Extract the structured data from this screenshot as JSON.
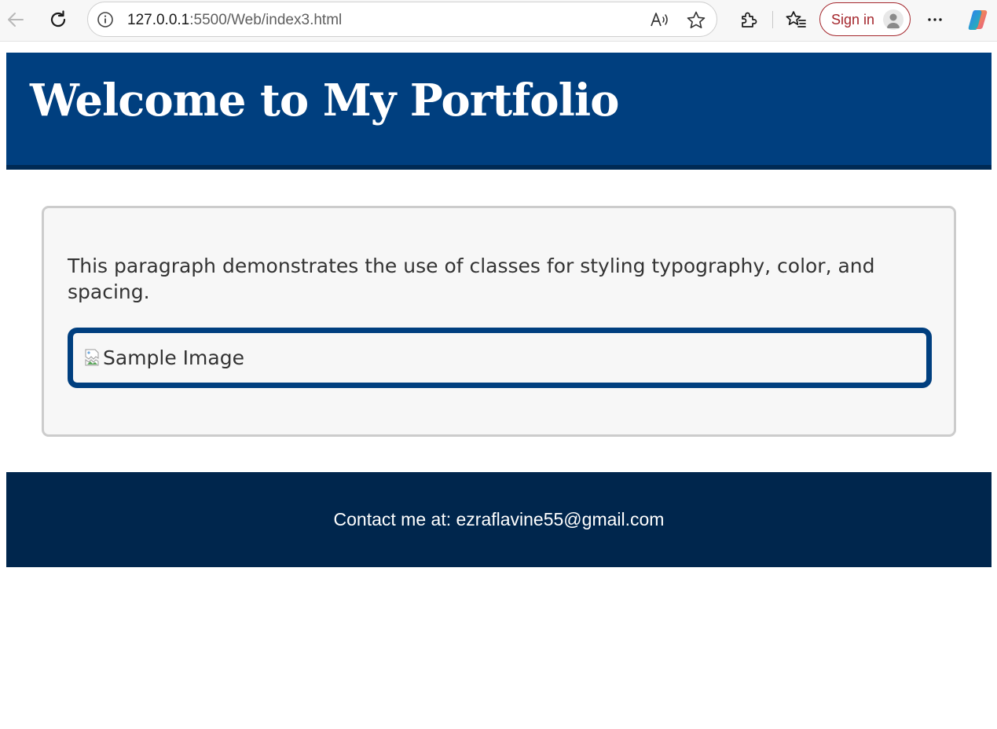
{
  "browser": {
    "url_host": "127.0.0.1",
    "url_path": ":5500/Web/index3.html",
    "signin_label": "Sign in"
  },
  "page": {
    "header": {
      "title": "Welcome to My Portfolio"
    },
    "content": {
      "intro_text": "This paragraph demonstrates the use of classes for styling typography, color, and spacing.",
      "image_alt": "Sample Image"
    },
    "footer": {
      "contact_text": "Contact me at: ezraflavine55@gmail.com"
    }
  },
  "colors": {
    "header_bg": "#003f7f",
    "footer_bg": "#00264d",
    "card_bg": "#f7f7f7",
    "signin_accent": "#a4262c"
  },
  "icons": [
    "back-arrow-icon",
    "refresh-icon",
    "info-icon",
    "read-aloud-icon",
    "favorite-star-icon",
    "extensions-icon",
    "favorites-icon",
    "avatar-icon",
    "more-options-icon",
    "copilot-icon",
    "broken-image-icon"
  ]
}
